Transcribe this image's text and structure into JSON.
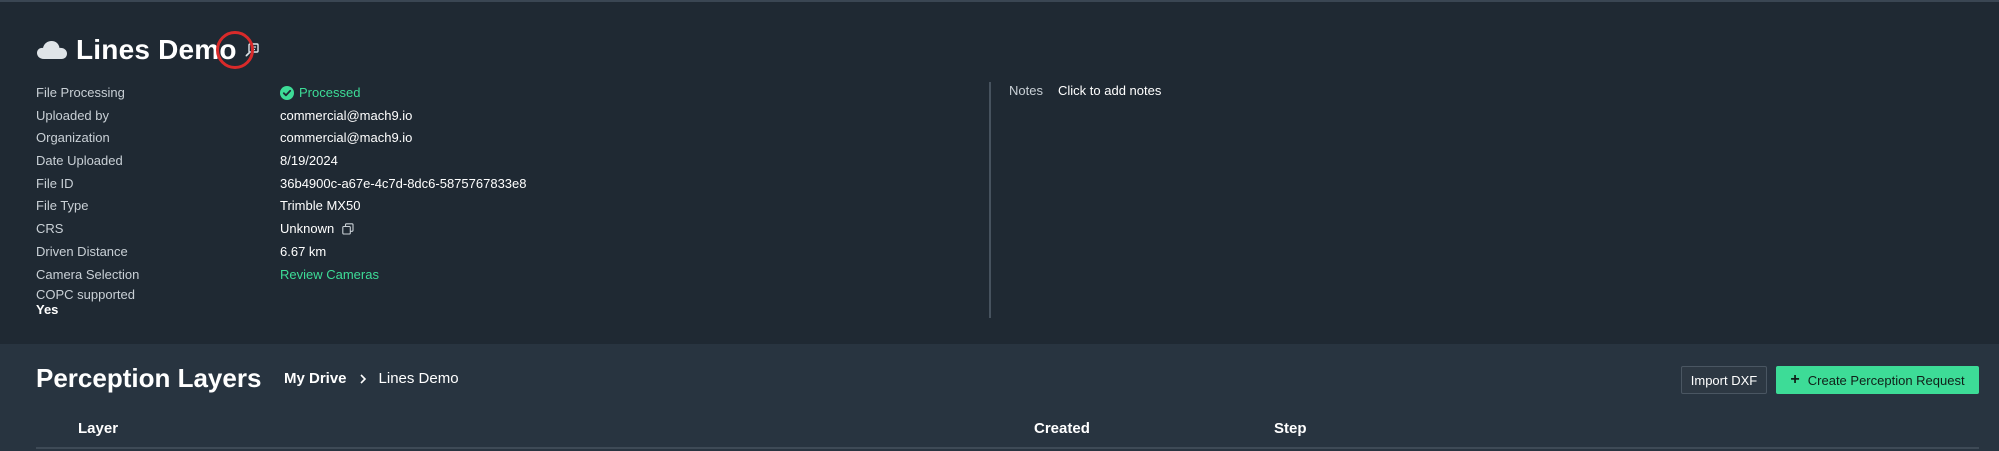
{
  "file": {
    "title": "Lines Demo",
    "details": [
      {
        "label": "File Processing",
        "value": "Processed",
        "status": "success"
      },
      {
        "label": "Uploaded by",
        "value": "commercial@mach9.io"
      },
      {
        "label": "Organization",
        "value": "commercial@mach9.io"
      },
      {
        "label": "Date Uploaded",
        "value": "8/19/2024"
      },
      {
        "label": "File ID",
        "value": "36b4900c-a67e-4c7d-8dc6-5875767833e8"
      },
      {
        "label": "File Type",
        "value": "Trimble MX50"
      },
      {
        "label": "CRS",
        "value": "Unknown"
      },
      {
        "label": "Driven Distance",
        "value": "6.67 km"
      },
      {
        "label": "Camera Selection",
        "value": "Review Cameras"
      }
    ],
    "copc": {
      "label": "COPC supported",
      "value": "Yes"
    },
    "notes": {
      "label": "Notes",
      "value": "Click to add notes"
    }
  },
  "layers": {
    "title": "Perception Layers",
    "breadcrumb": {
      "root": "My Drive",
      "current": "Lines Demo"
    },
    "import_label": "Import DXF",
    "create_label": "Create Perception Request",
    "columns": [
      "Layer",
      "Created",
      "Step"
    ]
  },
  "colors": {
    "accent": "#3ddc97",
    "background": "#1f2933",
    "panel": "#283440",
    "highlight": "#d92a2a"
  },
  "icons": [
    "cloud-icon",
    "edit-icon",
    "check-circle-icon",
    "copy-icon",
    "chevron-right-icon",
    "plus-icon"
  ]
}
